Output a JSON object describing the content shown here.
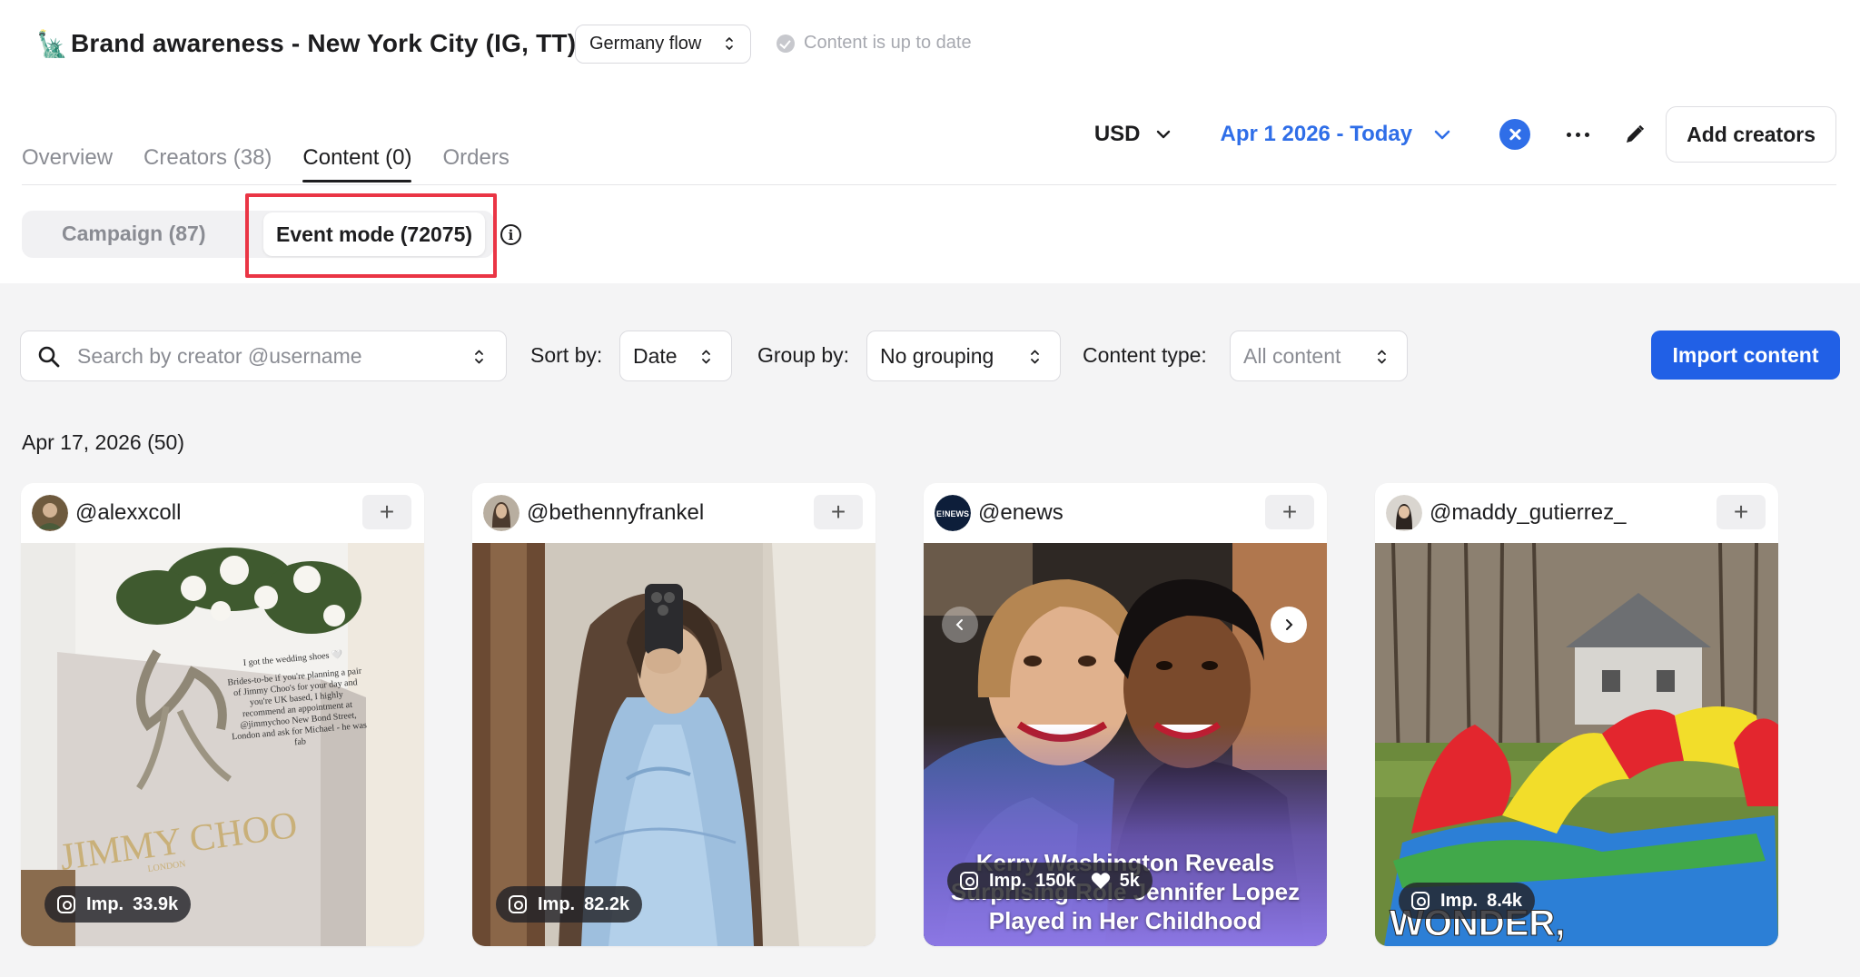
{
  "header": {
    "emoji": "🗽",
    "title": "Brand awareness - New York City (IG, TT)",
    "flow_select": "Germany flow",
    "status": "Content is up to date"
  },
  "tabs": [
    {
      "label": "Overview",
      "active": false
    },
    {
      "label": "Creators (38)",
      "active": false
    },
    {
      "label": "Content (0)",
      "active": true
    },
    {
      "label": "Orders",
      "active": false
    }
  ],
  "tools": {
    "currency": "USD",
    "date_range": "Apr 1 2026 - Today",
    "add_creators": "Add creators"
  },
  "segment": {
    "campaign": "Campaign (87)",
    "event": "Event mode (72075)"
  },
  "filters": {
    "search_placeholder": "Search by creator @username",
    "sort_label": "Sort by:",
    "sort_value": "Date",
    "group_label": "Group by:",
    "group_value": "No grouping",
    "type_label": "Content type:",
    "type_value": "All content",
    "import_button": "Import content"
  },
  "group_heading": "Apr 17, 2026 (50)",
  "cards": [
    {
      "handle": "@alexxcoll",
      "imp_label": "Imp.",
      "imp": "33.9k",
      "img_note": "I got the wedding shoes 🤍",
      "img_body": "Brides-to-be if you're planning a pair of Jimmy Choo's for your day and you're UK based, I highly recommend an appointment at @jimmychoo New Bond Street, London and ask for Michael - he was fab",
      "brand": "JIMMY CHOO",
      "brand_sub": "LONDON"
    },
    {
      "handle": "@bethennyfrankel",
      "imp_label": "Imp.",
      "imp": "82.2k"
    },
    {
      "handle": "@enews",
      "imp_label": "Imp.",
      "imp": "150k",
      "likes": "5k",
      "headline_1": "Kerry Washington Reveals",
      "headline_2": "Surprising Role Jennifer Lopez",
      "headline_3": "Played in Her Childhood",
      "avatar_text": "E!NEWS"
    },
    {
      "handle": "@maddy_gutierrez_",
      "imp_label": "Imp.",
      "imp": "8.4k",
      "caption": "WONDER,"
    }
  ],
  "colors": {
    "accent": "#2160e6",
    "highlight": "#ea3545",
    "page_bg": "#f4f4f5"
  }
}
